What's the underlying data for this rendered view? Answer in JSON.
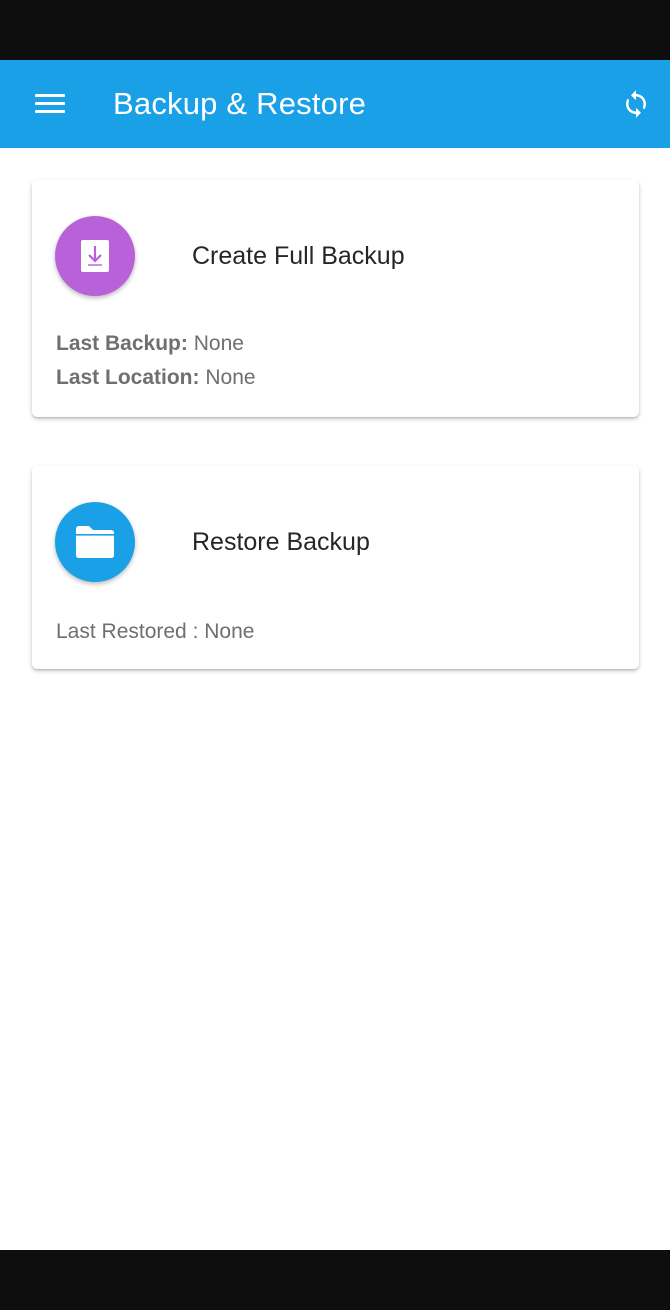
{
  "app_bar": {
    "title": "Backup & Restore",
    "menu_icon": "hamburger-menu-icon",
    "sync_icon": "sync-icon"
  },
  "cards": {
    "backup": {
      "title": "Create Full Backup",
      "icon": "download-icon",
      "icon_color": "#b961d8",
      "last_backup_label": "Last Backup:",
      "last_backup_value": "None",
      "last_location_label": "Last Location:",
      "last_location_value": "None"
    },
    "restore": {
      "title": "Restore Backup",
      "icon": "folder-icon",
      "icon_color": "#1aa0e6",
      "last_restored_text": "Last Restored : None"
    }
  },
  "colors": {
    "primary": "#1aa0e6",
    "accent_purple": "#b961d8",
    "system_bar": "#0e0e0e"
  }
}
